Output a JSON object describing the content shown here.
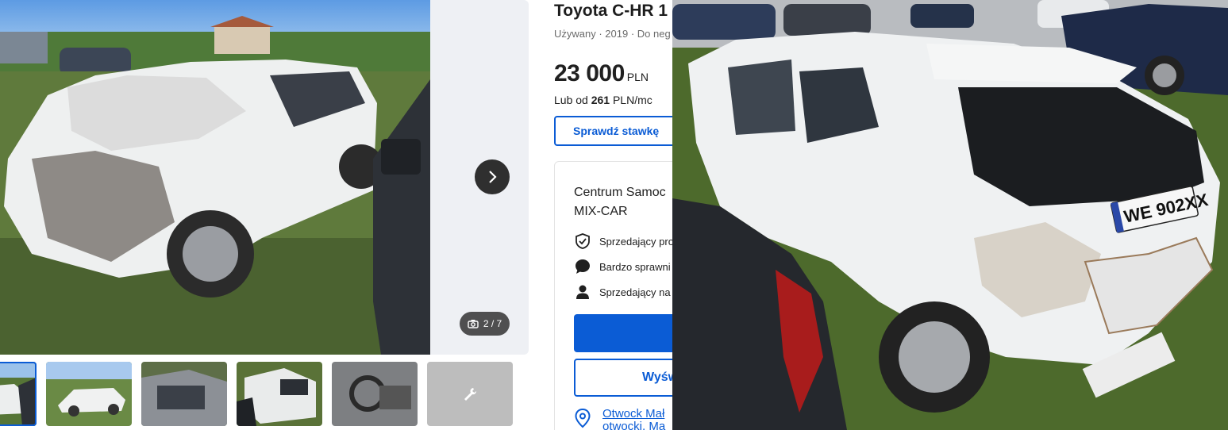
{
  "gallery": {
    "counter": "2 / 7",
    "thumbnails": [
      "thumb-1",
      "thumb-2",
      "thumb-3",
      "thumb-4",
      "thumb-5",
      "thumb-6"
    ]
  },
  "listing": {
    "title": "Toyota C-HR 1",
    "subtitle": "Używany · 2019 · Do neg",
    "price": "23 000",
    "currency": "PLN",
    "installment_prefix": "Lub od",
    "installment_amount": "261",
    "installment_suffix": "PLN/mc",
    "rate_button": "Sprawdź stawkę"
  },
  "seller": {
    "name_line1": "Centrum Samoc",
    "name_line2": "MIX-CAR",
    "features": [
      "Sprzedający pro",
      "Bardzo sprawni",
      "Sprzedający na"
    ],
    "secondary_button": "Wyśw",
    "location_line1": "Otwock Mał",
    "location_line2": "otwocki, Ma"
  },
  "plate_text": "WE 902XX",
  "colors": {
    "accent": "#0b5cd5"
  }
}
